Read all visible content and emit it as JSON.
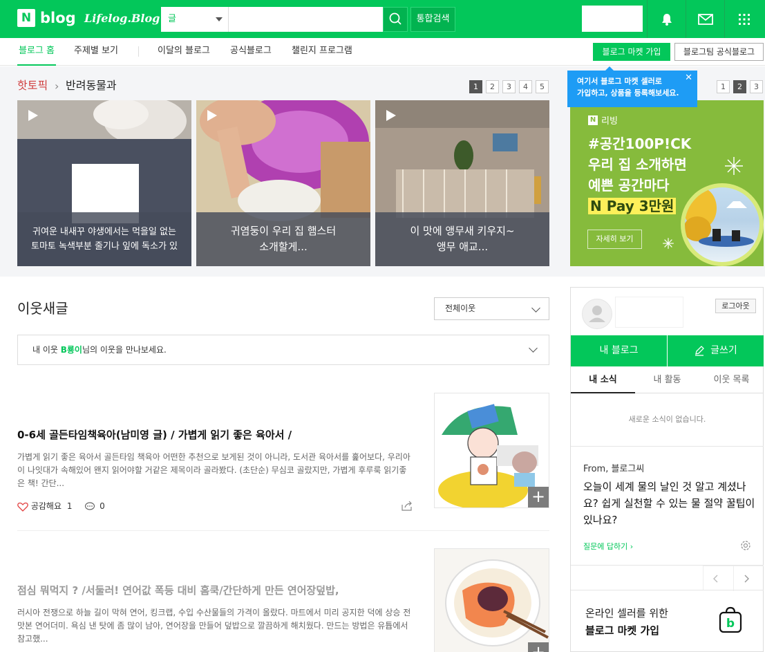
{
  "header": {
    "logo_n": "N",
    "logo_blog": "blog",
    "logo_life": "Lifelog.Blog",
    "search_scope": "글",
    "search_placeholder": "",
    "total_search": "통합검색"
  },
  "nav": {
    "items": [
      "블로그 홈",
      "주제별 보기",
      "이달의 블로그",
      "공식블로그",
      "챌린지 프로그램"
    ],
    "market_button": "블로그 마켓 가입",
    "official_button": "블로그팀 공식블로그"
  },
  "hot_topic": {
    "label": "핫토픽",
    "category": "반려동물과",
    "pages": [
      "1",
      "2",
      "3",
      "4",
      "5"
    ],
    "current_page": "1",
    "cards": [
      {
        "caption_line1": "귀여운 내새꾸 야생에서는 먹을일 없는",
        "caption_line2": "토마토 녹색부분 줄기나 잎에 독소가 있"
      },
      {
        "caption_line1": "귀염둥이 우리 집 햄스터",
        "caption_line2": "소개할게..."
      },
      {
        "caption_line1": "이 맛에 앵무새 키우지~",
        "caption_line2": "앵무 애교..."
      }
    ]
  },
  "tooltip": {
    "line1": "여기서 블로그 마켓 셀러로",
    "line2": "가입하고, 상품을 등록해보세요.",
    "close": "✕"
  },
  "ad": {
    "pages": [
      "1",
      "2",
      "3"
    ],
    "current_page": "2",
    "n_logo": "N",
    "brand": "리빙",
    "line1": "#공간100P!CK",
    "line2": "우리 집 소개하면",
    "line3": "예쁜 공간마다",
    "line4": "N Pay 3만원",
    "button": "자세히 보기"
  },
  "main": {
    "section_title": "이웃새글",
    "filter_value": "전체이웃",
    "notice_prefix": "내 이웃 ",
    "notice_highlight": "B룡이",
    "notice_suffix": "님의 이웃을 만나보세요.",
    "posts": [
      {
        "title": "0-6세 골든타임책육아(남미영 글) / 가볍게 읽기 좋은 육아서 /",
        "body": "가볍게 읽기 좋은 육아서 골든타임 책육아 어떤한 추천으로 보게된 것이 아니라, 도서관 육아서를 훑어보다, 우리아이 나잇대가 속해있어 왠지 읽어야할 거같은 제목이라 골라봤다. (초단순) 무심코 골랐지만, 가볍게 후루룩 읽기좋은 책! 간단...",
        "like_label": "공감해요",
        "like_count": "1",
        "comment_count": "0"
      },
      {
        "title": "점심 뭐먹지 ? /서둘러! 연어값 폭등 대비 홈쿡/간단하게 만든 연어장덮밥,",
        "body": "러시아 전쟁으로 하늘 길이 막혀 연어, 킹크랩, 수입 수산물들의 가격이 올랐다. 마트에서 미리 공지한 덕에 상승 전 맛본 연어더미. 욕심 낸 탓에 좀 많이 남아, 연어장을 만들어 덮밥으로 깔끔하게 해치웠다. 만드는 방법은 유튭에서 참고했..."
      }
    ]
  },
  "panel": {
    "logout": "로그아웃",
    "my_blog": "내 블로그",
    "write": "글쓰기",
    "tabs": [
      "내 소식",
      "내 활동",
      "이웃 목록"
    ],
    "empty_message": "새로운 소식이 없습니다.",
    "from": "From, 블로그씨",
    "question": "오늘이 세계 물의 날인 것 알고 계셨나요? 쉽게 실천할 수 있는 물 절약 꿀팁이 있나요?",
    "answer_link": "질문에 답하기 ›",
    "seller_line1": "온라인 셀러를 위한",
    "seller_line2": "블로그 마켓 가입",
    "bag_letter": "b"
  },
  "colors": {
    "brand_green": "#03c75a",
    "tooltip_blue": "#1e9cf5",
    "ad_green": "#86bb3c",
    "hot_red": "#d04040"
  }
}
